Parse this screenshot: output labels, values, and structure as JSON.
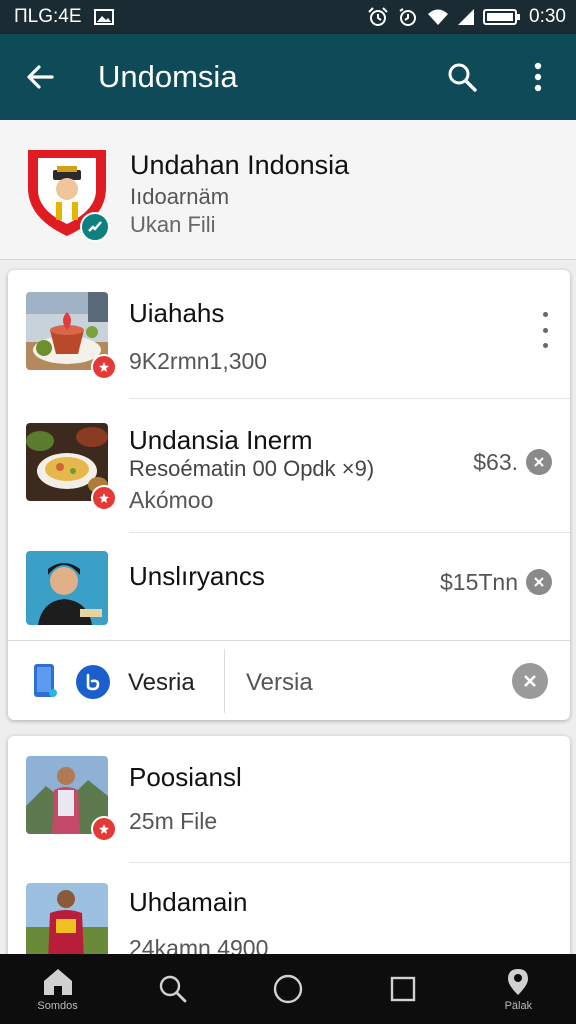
{
  "status_bar": {
    "left_text": "ПLG:4E",
    "time": "0:30"
  },
  "app_bar": {
    "title": "Undomsia"
  },
  "app": {
    "name": "Undahan Indonsia",
    "developer": "Iıdoarnäm",
    "subtitle": "Ukan Fili"
  },
  "items": [
    {
      "title": "Uiahahs",
      "detail": "9K2rmn1,300"
    },
    {
      "title": "Undansia Inerm",
      "detail": "Resoématin 00 Opdk ×9)",
      "extra": "Akómoo",
      "price": "$63."
    },
    {
      "title": "Unslıryancs",
      "price": "$15Tnn"
    }
  ],
  "version": {
    "label": "Vesria",
    "value": "Versia"
  },
  "items2": [
    {
      "title": "Poosiansl",
      "detail": "25m File"
    },
    {
      "title": "Uhdamain",
      "detail": "24kamn 4900"
    }
  ],
  "nav": [
    {
      "label": "Somdos",
      "icon": "home-icon"
    },
    {
      "label": "",
      "icon": "search-icon"
    },
    {
      "label": "",
      "icon": "circle-home-icon"
    },
    {
      "label": "",
      "icon": "square-recents-icon"
    },
    {
      "label": "Pälak",
      "icon": "pin-icon"
    }
  ],
  "colors": {
    "status_bar": "#1b2b33",
    "app_bar": "#0e4a57",
    "badge": "#e53935",
    "nav_bar": "#0d0d0d"
  }
}
